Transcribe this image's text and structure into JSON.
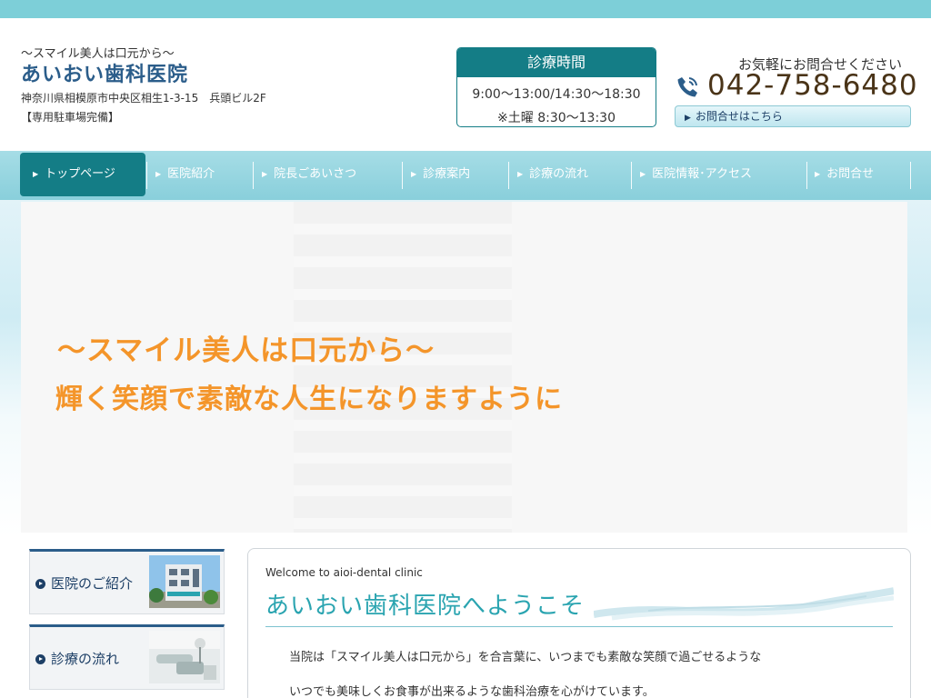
{
  "header": {
    "tagline": "〜スマイル美人は口元から〜",
    "clinic_name": "あいおい歯科医院",
    "address": "神奈川県相模原市中央区相生1-3-15　兵頭ビル2F",
    "parking": "【専用駐車場完備】"
  },
  "hours": {
    "title": "診療時間",
    "line1": "9:00〜13:00/14:30〜18:30",
    "line2": "※土曜 8:30〜13:30"
  },
  "contact": {
    "lead": "お気軽にお問合せください",
    "phone": "042-758-6480",
    "button_label": "お問合せはこちら",
    "icon": "phone-icon"
  },
  "nav": {
    "items": [
      {
        "label": "トップページ",
        "active": true
      },
      {
        "label": "医院紹介"
      },
      {
        "label": "院長ごあいさつ"
      },
      {
        "label": "診療案内"
      },
      {
        "label": "診療の流れ"
      },
      {
        "label": "医院情報･アクセス"
      },
      {
        "label": "お問合せ"
      }
    ]
  },
  "hero": {
    "line1": "〜スマイル美人は口元から〜",
    "line2": "輝く笑顔で素敵な人生になりますように"
  },
  "sidebar": {
    "items": [
      {
        "label": "医院のご紹介"
      },
      {
        "label": "診療の流れ"
      }
    ]
  },
  "welcome": {
    "subtitle": "Welcome to aioi-dental clinic",
    "title": "あいおい歯科医院へようこそ",
    "p1": "当院は「スマイル美人は口元から」を合言葉に、いつまでも素敵な笑顔で過ごせるような",
    "p2": "いつでも美味しくお食事が出来るような歯科治療を心がけています。"
  },
  "colors": {
    "teal": "#147d86",
    "nav_bg": "#8fd2dd",
    "brand_blue": "#2b5d8a",
    "hero_orange": "#f4952a",
    "welcome_title": "#2aa4b0"
  }
}
